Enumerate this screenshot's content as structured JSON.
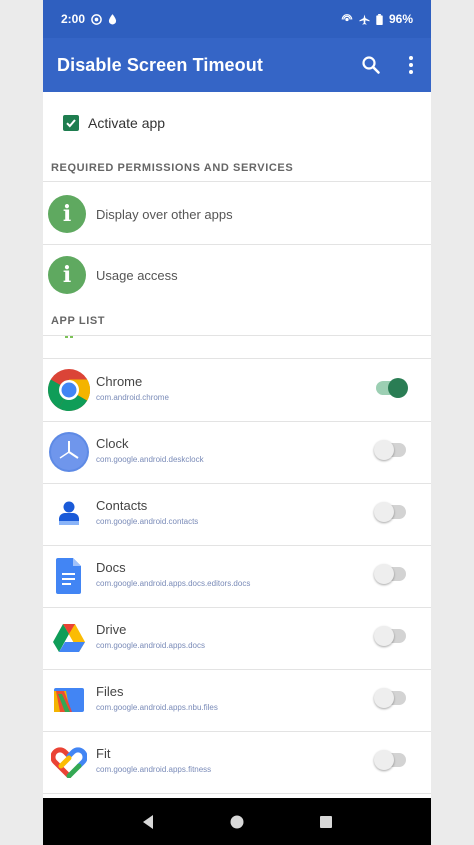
{
  "status_bar": {
    "time": "2:00",
    "battery": "96%"
  },
  "app_bar": {
    "title": "Disable Screen Timeout",
    "actions": [
      "search-icon",
      "more-vert-icon"
    ]
  },
  "activate": {
    "label": "Activate app",
    "checked": true
  },
  "permissions": {
    "header": "REQUIRED PERMISSIONS AND SERVICES",
    "items": [
      {
        "label": "Display over other apps",
        "icon": "info-icon"
      },
      {
        "label": "Usage access",
        "icon": "info-icon"
      }
    ]
  },
  "app_list": {
    "header": "APP LIST",
    "items": [
      {
        "name": "",
        "package": "",
        "enabled": false,
        "icon": "android-icon"
      },
      {
        "name": "Chrome",
        "package": "com.android.chrome",
        "enabled": true,
        "icon": "chrome-icon"
      },
      {
        "name": "Clock",
        "package": "com.google.android.deskclock",
        "enabled": false,
        "icon": "clock-icon"
      },
      {
        "name": "Contacts",
        "package": "com.google.android.contacts",
        "enabled": false,
        "icon": "contacts-icon"
      },
      {
        "name": "Docs",
        "package": "com.google.android.apps.docs.editors.docs",
        "enabled": false,
        "icon": "docs-icon"
      },
      {
        "name": "Drive",
        "package": "com.google.android.apps.docs",
        "enabled": false,
        "icon": "drive-icon"
      },
      {
        "name": "Files",
        "package": "com.google.android.apps.nbu.files",
        "enabled": false,
        "icon": "files-icon"
      },
      {
        "name": "Fit",
        "package": "com.google.android.apps.fitness",
        "enabled": false,
        "icon": "fit-icon"
      }
    ]
  },
  "nav_bar": [
    "back-icon",
    "home-icon",
    "recents-icon"
  ],
  "colors": {
    "status_bar": "#2f5fbf",
    "app_bar": "#3565c6",
    "accent": "#2a7d54",
    "permission_icon": "#5fa960"
  }
}
